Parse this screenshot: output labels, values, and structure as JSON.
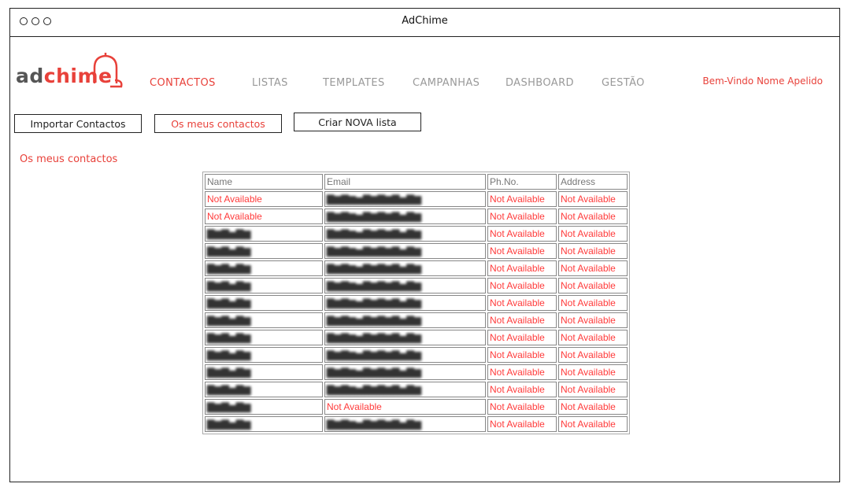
{
  "window": {
    "title": "AdChime"
  },
  "logo": {
    "part1": "ad",
    "part2": "chime"
  },
  "nav": [
    "CONTACTOS",
    "LISTAS",
    "TEMPLATES",
    "CAMPANHAS",
    "DASHBOARD",
    "GESTÃO"
  ],
  "user": {
    "welcome": "Bem-Vindo Nome Apelido"
  },
  "actions": {
    "import": "Importar Contactos",
    "my_contacts": "Os meus contactos",
    "new_list": "Criar NOVA lista"
  },
  "section": {
    "title": "Os meus contactos"
  },
  "table": {
    "headers": [
      "Name",
      "Email",
      "Ph.No.",
      "Address"
    ],
    "rows": [
      [
        "Not Available",
        "",
        "Not Available",
        "Not Available"
      ],
      [
        "Not Available",
        "",
        "Not Available",
        "Not Available"
      ],
      [
        "",
        "",
        "Not Available",
        "Not Available"
      ],
      [
        "",
        "",
        "Not Available",
        "Not Available"
      ],
      [
        "",
        "",
        "Not Available",
        "Not Available"
      ],
      [
        "",
        "",
        "Not Available",
        "Not Available"
      ],
      [
        "",
        "",
        "Not Available",
        "Not Available"
      ],
      [
        "",
        "",
        "Not Available",
        "Not Available"
      ],
      [
        "",
        "",
        "Not Available",
        "Not Available"
      ],
      [
        "",
        "",
        "Not Available",
        "Not Available"
      ],
      [
        "",
        "",
        "Not Available",
        "Not Available"
      ],
      [
        "",
        "",
        "Not Available",
        "Not Available"
      ],
      [
        "",
        "Not Available",
        "Not Available",
        "Not Available"
      ],
      [
        "",
        "",
        "Not Available",
        "Not Available"
      ]
    ]
  },
  "colors": {
    "accent": "#e8413a",
    "muted": "#999999",
    "unavailable": "#ff3a3a"
  }
}
